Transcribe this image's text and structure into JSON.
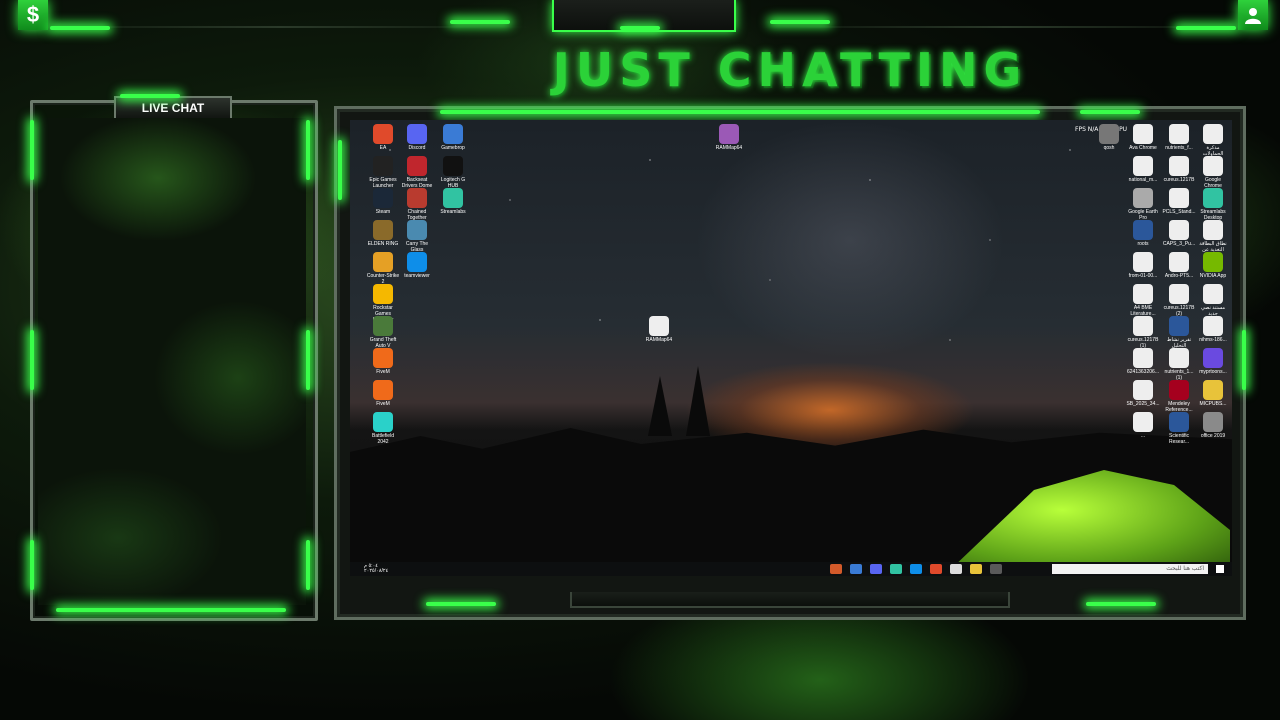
{
  "overlay": {
    "title": "JUST CHATTING",
    "chat_label": "LIVE CHAT",
    "accent_color": "#39ff4a",
    "donate_icon": "dollar-icon",
    "profile_icon": "user-icon",
    "donate_glyph": "$"
  },
  "desktop": {
    "perf_readout": "FPS N/A GPU CPU",
    "left_icons": [
      {
        "label": "EA",
        "icon": "ea-icon",
        "color": "#e04a2b"
      },
      {
        "label": "Discord",
        "icon": "discord-icon",
        "color": "#5865f2"
      },
      {
        "label": "Gamebrop",
        "icon": "gamepad-icon",
        "color": "#3a7bd5"
      },
      {
        "label": "Epic Games Launcher",
        "icon": "epic-icon",
        "color": "#222"
      },
      {
        "label": "Backseat Drivers Dome",
        "icon": "car-icon",
        "color": "#c0262d"
      },
      {
        "label": "Logitech G HUB",
        "icon": "logitech-icon",
        "color": "#111"
      },
      {
        "label": "Steam",
        "icon": "steam-icon",
        "color": "#1b2838"
      },
      {
        "label": "Chained Together",
        "icon": "chain-icon",
        "color": "#b93b2f"
      },
      {
        "label": "Streamlabs",
        "icon": "streamlabs-icon",
        "color": "#31c3a2"
      },
      {
        "label": "ELDEN RING",
        "icon": "eldenring-icon",
        "color": "#8a6a2a"
      },
      {
        "label": "Carry The Glass",
        "icon": "glass-icon",
        "color": "#4a8ab0"
      },
      {
        "label": "Counter-Strike 2",
        "icon": "cs2-icon",
        "color": "#e5a025"
      },
      {
        "label": "teamviewer",
        "icon": "teamviewer-icon",
        "color": "#0e8ee9"
      },
      {
        "label": "Rockstar Games Launcher",
        "icon": "rockstar-icon",
        "color": "#f5b800"
      },
      {
        "label": "Grand Theft Auto V",
        "icon": "gta-icon",
        "color": "#4a7a3a"
      },
      {
        "label": "FiveM",
        "icon": "fivem-icon",
        "color": "#f06a1a"
      },
      {
        "label": "FiveM",
        "icon": "fivem-icon",
        "color": "#f06a1a"
      },
      {
        "label": "Battlefield 2042",
        "icon": "battlefield-icon",
        "color": "#2ad1c9"
      }
    ],
    "center_icons": [
      {
        "label": "RAMMap64",
        "icon": "rammap-icon",
        "color": "#9b59b6"
      },
      {
        "label": "RAMMap64",
        "icon": "chrome-icon",
        "color": "#eeeeee"
      }
    ],
    "right_icons": [
      {
        "label": "qosh",
        "icon": "app-icon",
        "color": "#777"
      },
      {
        "label": "Ava Chrome",
        "icon": "chrome-icon",
        "color": "#eeeeee"
      },
      {
        "label": "nutrients_f...",
        "icon": "chrome-icon",
        "color": "#eeeeee"
      },
      {
        "label": "مذكرة الحماولات",
        "icon": "chrome-icon",
        "color": "#eeeeee"
      },
      {
        "label": "national_m...",
        "icon": "chrome-icon",
        "color": "#eeeeee"
      },
      {
        "label": "cureus.1217B",
        "icon": "chrome-icon",
        "color": "#eeeeee"
      },
      {
        "label": "Google Chrome",
        "icon": "chrome-icon",
        "color": "#eeeeee"
      },
      {
        "label": "Google Earth Pro",
        "icon": "earth-icon",
        "color": "#aaaaaa"
      },
      {
        "label": "PCLS_Stand...",
        "icon": "chrome-icon",
        "color": "#eeeeee"
      },
      {
        "label": "Streamlabs Desktop",
        "icon": "streamlabs-icon",
        "color": "#31c3a2"
      },
      {
        "label": "roots",
        "icon": "word-icon",
        "color": "#2b579a"
      },
      {
        "label": "CAPS_3_Pu...",
        "icon": "chrome-icon",
        "color": "#eeeeee"
      },
      {
        "label": "نطاق البطاقة التغذية عن",
        "icon": "doc-icon",
        "color": "#eeeeee"
      },
      {
        "label": "from-01-00...",
        "icon": "chrome-icon",
        "color": "#eeeeee"
      },
      {
        "label": "Andro-PT5...",
        "icon": "chrome-icon",
        "color": "#eeeeee"
      },
      {
        "label": "NVIDIA App",
        "icon": "nvidia-icon",
        "color": "#76b900"
      },
      {
        "label": "A4 BME Literature...",
        "icon": "chrome-icon",
        "color": "#eeeeee"
      },
      {
        "label": "cureus.1217B (2)",
        "icon": "chrome-icon",
        "color": "#eeeeee"
      },
      {
        "label": "مستند نصي جديد",
        "icon": "text-file-icon",
        "color": "#eeeeee"
      },
      {
        "label": "cureus.1217B (1)",
        "icon": "chrome-icon",
        "color": "#eeeeee"
      },
      {
        "label": "تقرير نشاط التحليل",
        "icon": "word-icon",
        "color": "#2b579a"
      },
      {
        "label": "nihms-186...",
        "icon": "chrome-icon",
        "color": "#eeeeee"
      },
      {
        "label": "6241363206...",
        "icon": "chrome-icon",
        "color": "#eeeeee"
      },
      {
        "label": "nutrients_1... (1)",
        "icon": "chrome-icon",
        "color": "#eeeeee"
      },
      {
        "label": "myprtoons...",
        "icon": "app-icon",
        "color": "#6a4ae0"
      },
      {
        "label": "SB_2025_34...",
        "icon": "chrome-icon",
        "color": "#eeeeee"
      },
      {
        "label": "Mendeley Reference...",
        "icon": "mendeley-icon",
        "color": "#a5001e"
      },
      {
        "label": "MICPUBS...",
        "icon": "folder-icon",
        "color": "#e8c33a"
      },
      {
        "label": "...",
        "icon": "doc-icon",
        "color": "#eeeeee"
      },
      {
        "label": "Scientific Resear...",
        "icon": "word-icon",
        "color": "#2b579a"
      },
      {
        "label": "office 2019",
        "icon": "app-icon",
        "color": "#8a8a8a"
      }
    ],
    "taskbar": {
      "time": "٥:٠٤ م",
      "date": "٢٠٢٥/٠٨/٢٤",
      "search_placeholder": "اكتب هنا للبحث"
    }
  }
}
